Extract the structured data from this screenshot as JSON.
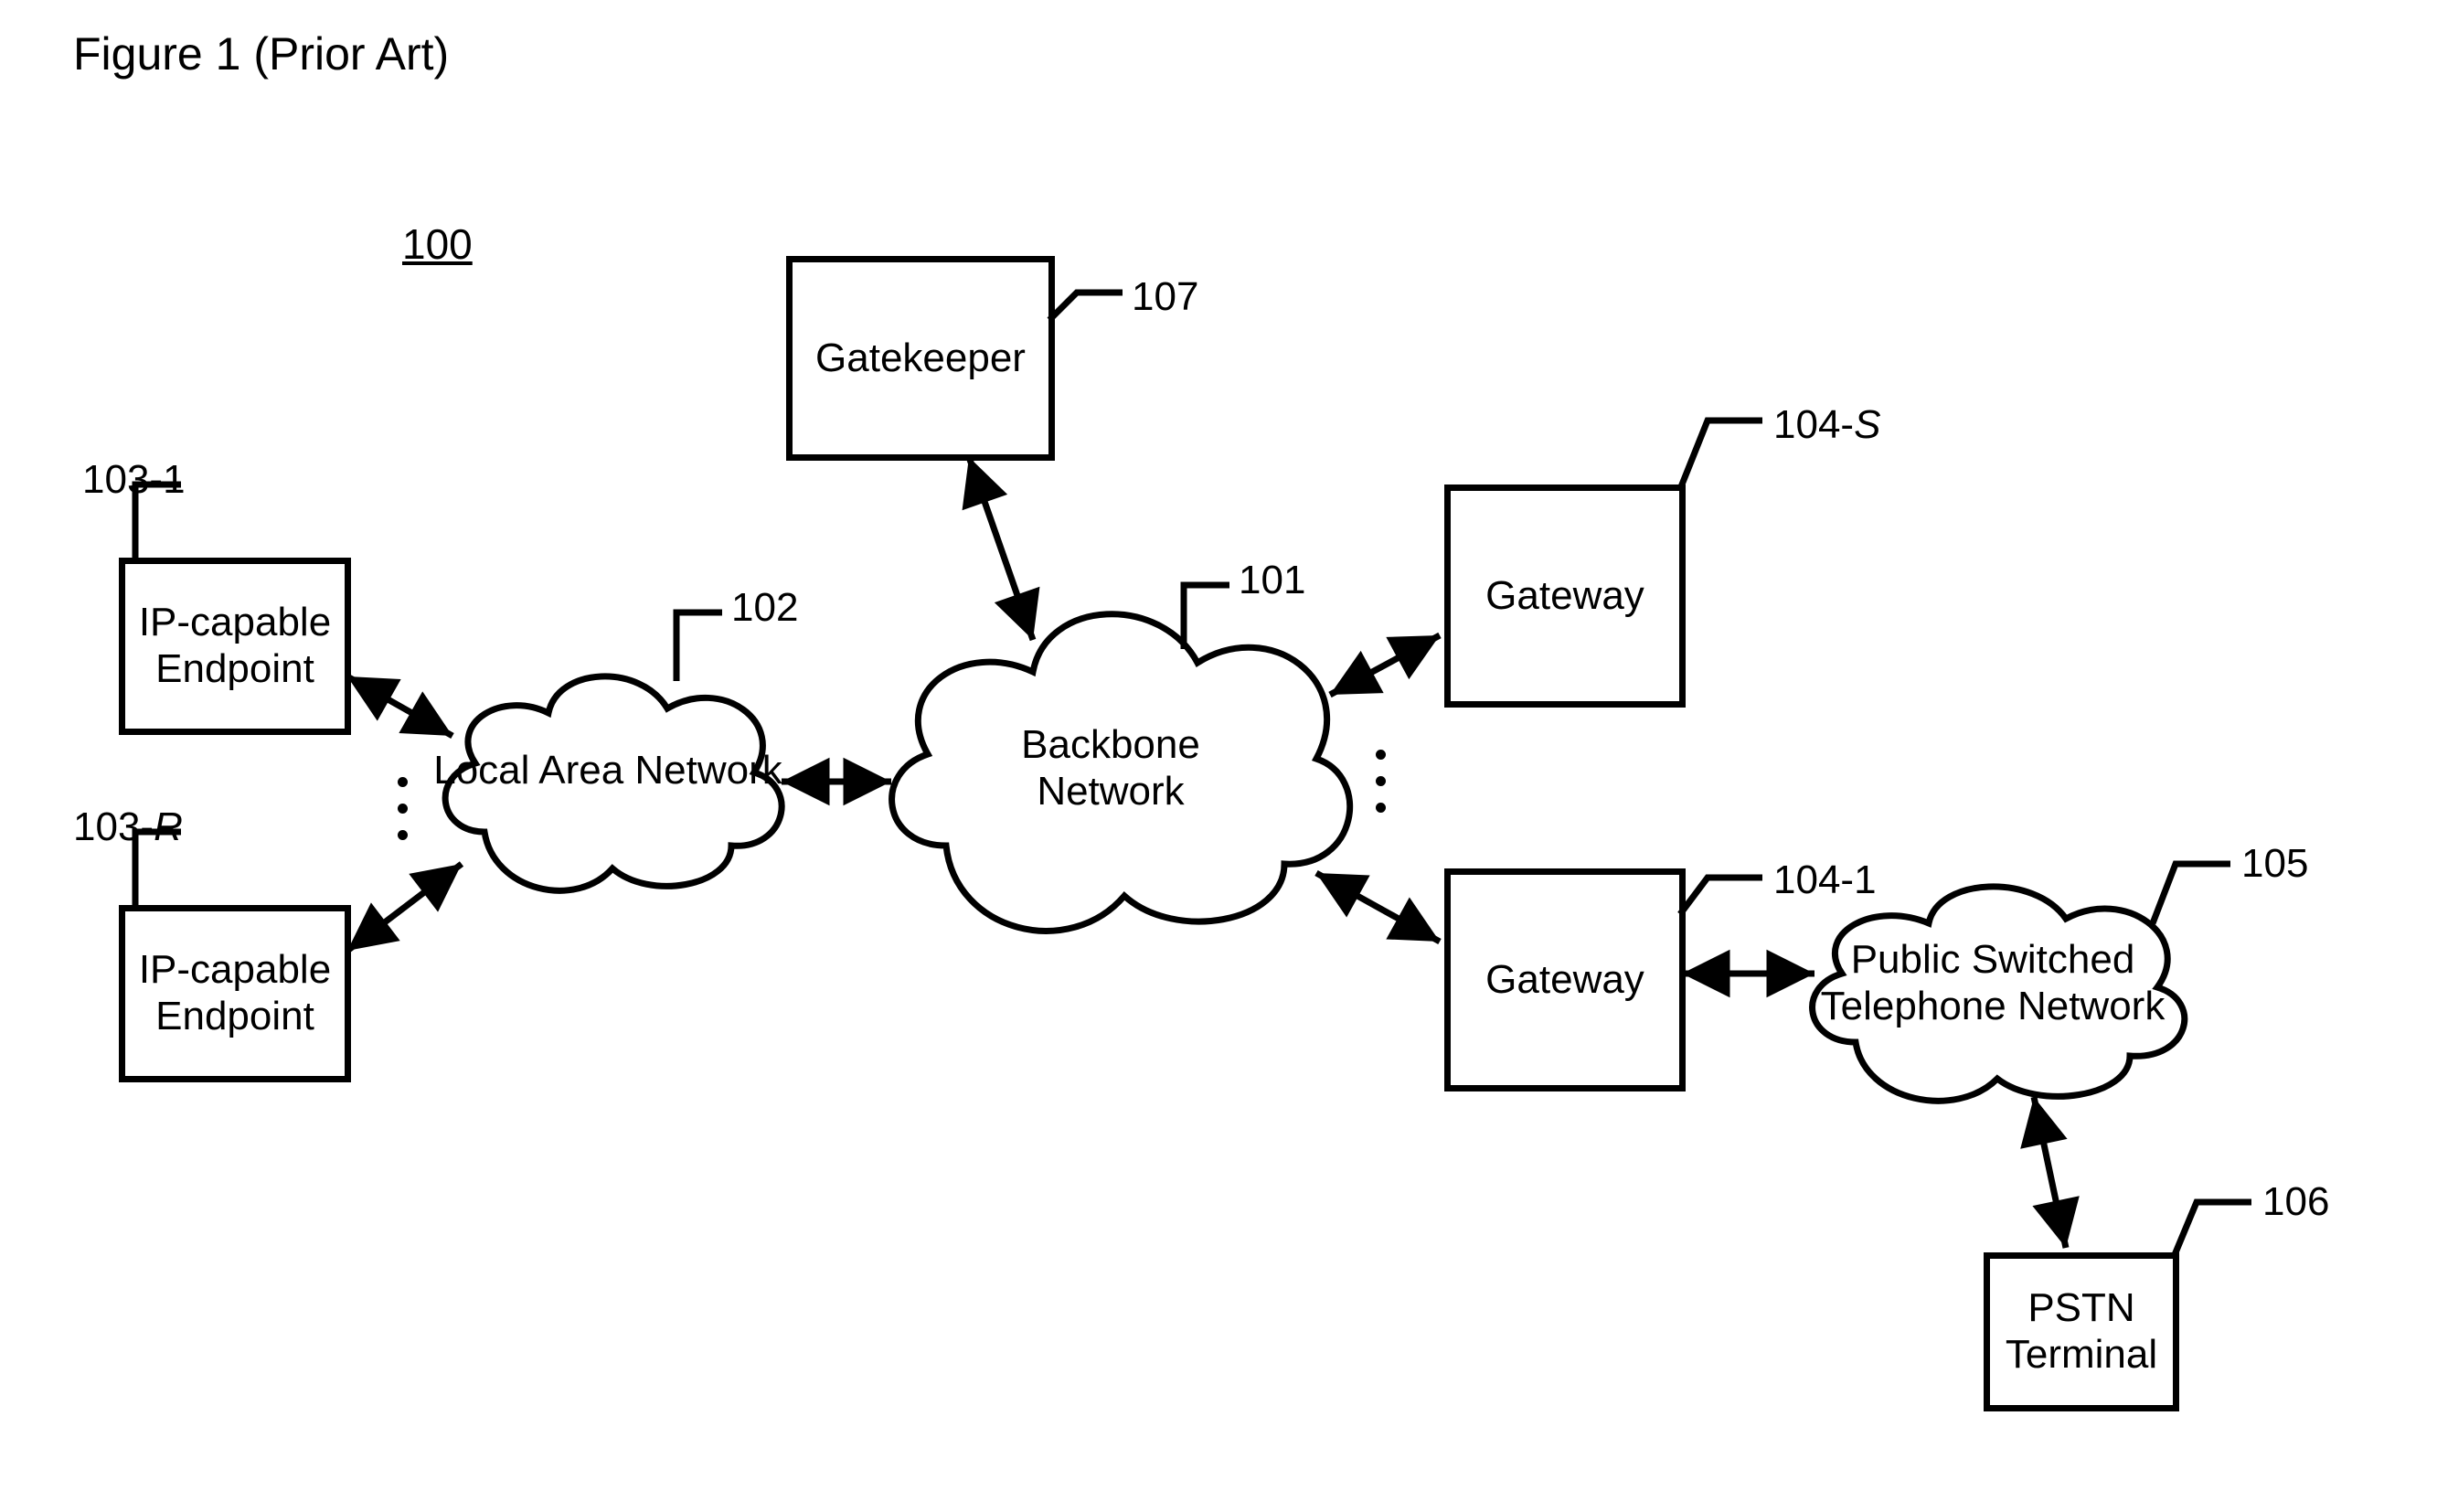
{
  "figure": {
    "title": "Figure 1 (Prior Art)",
    "number": "100"
  },
  "nodes": {
    "ipEndpoint1": {
      "label": "IP-capable\nEndpoint",
      "ref": "103-1"
    },
    "ipEndpointR": {
      "label": "IP-capable\nEndpoint",
      "ref": "103-",
      "refItalic": "R"
    },
    "lan": {
      "label": "Local Area Network",
      "ref": "102"
    },
    "gatekeeper": {
      "label": "Gatekeeper",
      "ref": "107"
    },
    "backbone": {
      "label": "Backbone\nNetwork",
      "ref": "101"
    },
    "gatewayS": {
      "label": "Gateway",
      "ref": "104-",
      "refItalic": "S"
    },
    "gateway1": {
      "label": "Gateway",
      "ref": "104-1"
    },
    "pstn": {
      "label": "Public Switched\nTelephone Network",
      "ref": "105"
    },
    "pstnTerm": {
      "label": "PSTN\nTerminal",
      "ref": "106"
    }
  }
}
